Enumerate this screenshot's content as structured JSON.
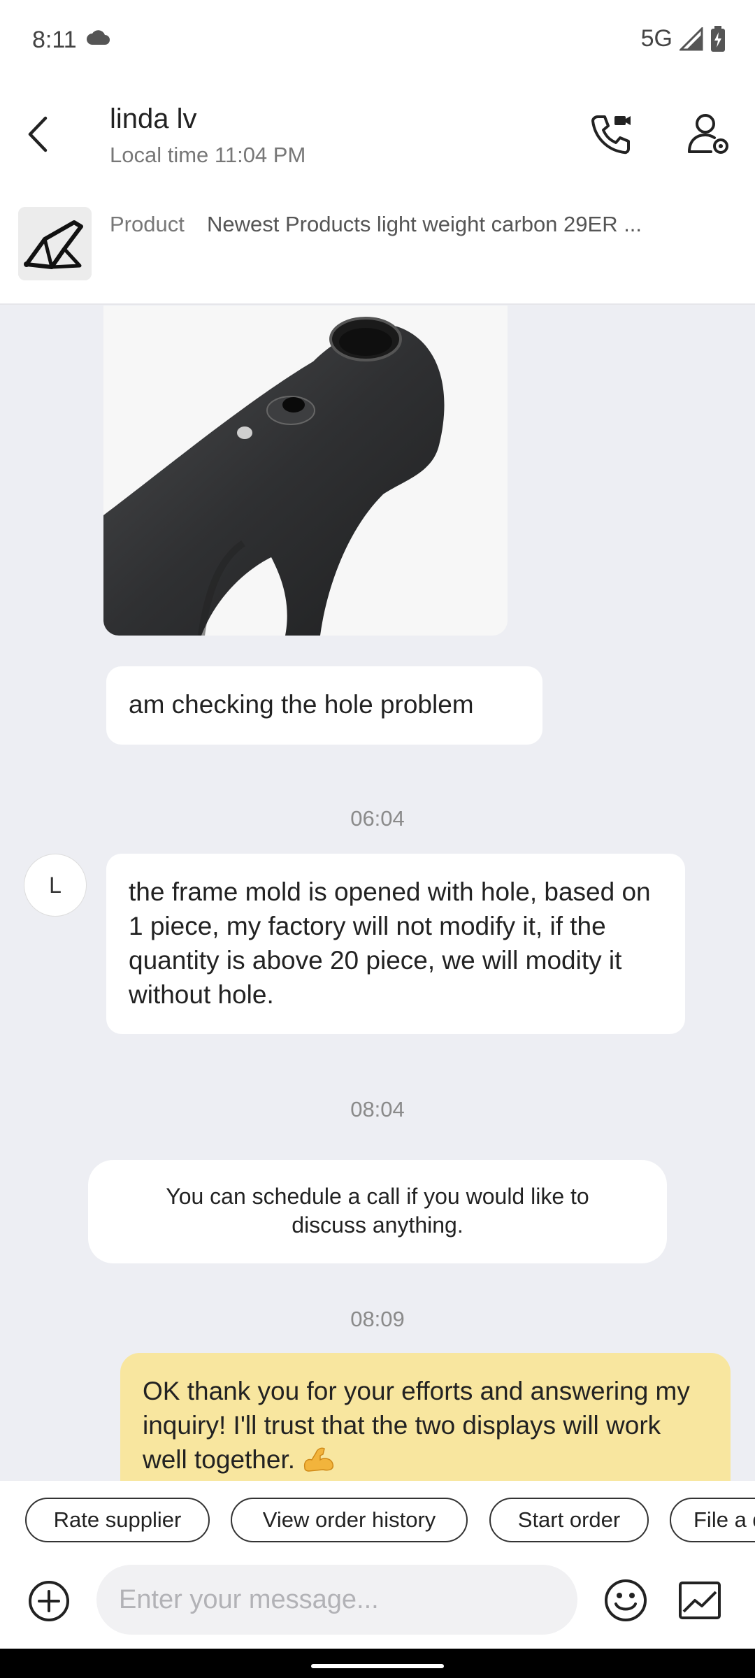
{
  "status_bar": {
    "time": "8:11",
    "network": "5G"
  },
  "header": {
    "contact_name": "linda lv",
    "local_time": "Local time 11:04 PM"
  },
  "product": {
    "label": "Product",
    "title": "Newest Products light weight carbon 29ER ..."
  },
  "messages": {
    "msg1": "am checking the hole problem",
    "time1": "06:04",
    "avatar_initial": "L",
    "msg2": "the frame mold is opened with hole, based on 1 piece, my factory will not modify it, if the quantity is above 20 piece, we will modity it without hole.",
    "time2": "08:04",
    "system_msg": "You can schedule a call if you would like to discuss anything.",
    "time3": "08:09",
    "msg3": "OK thank you for your efforts and answering my inquiry! I'll trust that the two displays will work well together."
  },
  "quick_actions": [
    "Rate supplier",
    "View order history",
    "Start order",
    "File a dispute"
  ],
  "composer": {
    "placeholder": "Enter your message..."
  },
  "colors": {
    "sent_bubble": "#f8e69f",
    "chat_background": "#edeef3"
  }
}
